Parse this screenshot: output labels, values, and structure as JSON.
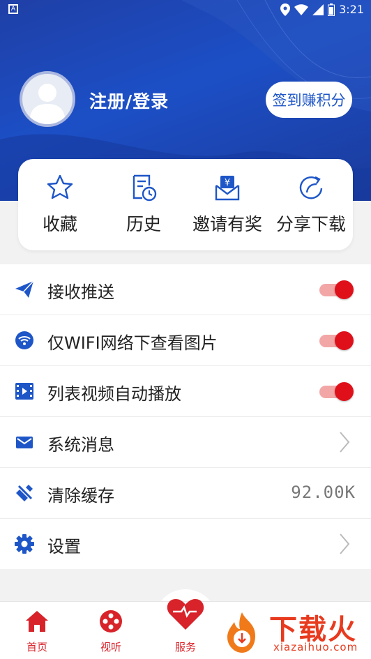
{
  "status_bar": {
    "time": "3:21",
    "left_icon": "app-notification-icon"
  },
  "profile": {
    "login_label": "注册/登录",
    "signin_button": "签到赚积分"
  },
  "quick_actions": [
    {
      "label": "收藏",
      "icon": "star-icon"
    },
    {
      "label": "历史",
      "icon": "history-icon"
    },
    {
      "label": "邀请有奖",
      "icon": "invite-reward-icon"
    },
    {
      "label": "分享下载",
      "icon": "share-icon"
    }
  ],
  "settings": [
    {
      "label": "接收推送",
      "icon": "send-icon",
      "type": "toggle",
      "on": true
    },
    {
      "label": "仅WIFI网络下查看图片",
      "icon": "wifi-icon",
      "type": "toggle",
      "on": true
    },
    {
      "label": "列表视频自动播放",
      "icon": "video-icon",
      "type": "toggle",
      "on": true
    },
    {
      "label": "系统消息",
      "icon": "mail-icon",
      "type": "link"
    },
    {
      "label": "清除缓存",
      "icon": "broom-icon",
      "type": "value",
      "value": "92.00K"
    },
    {
      "label": "设置",
      "icon": "gear-icon",
      "type": "link"
    }
  ],
  "tabs": [
    {
      "label": "首页",
      "icon": "home-icon"
    },
    {
      "label": "视听",
      "icon": "media-icon"
    },
    {
      "label": "服务",
      "icon": "heart-icon"
    }
  ],
  "watermark": {
    "text": "下载火",
    "sub": "xiazaihuo.com"
  },
  "colors": {
    "primary": "#1e56c8",
    "accent": "#e0101a",
    "hero": "#1c4fc6"
  }
}
